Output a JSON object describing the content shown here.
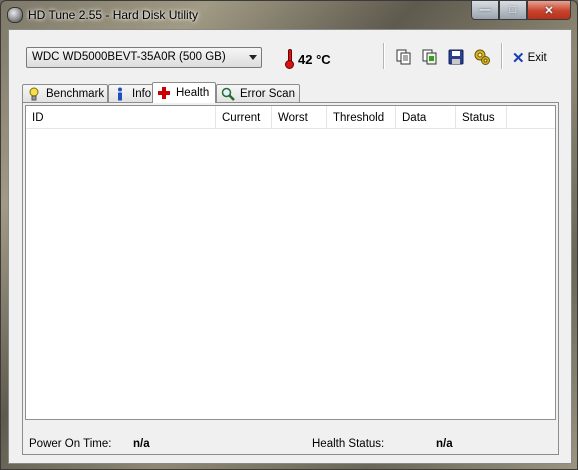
{
  "window": {
    "title": "HD Tune 2.55 - Hard Disk Utility",
    "caption_buttons": {
      "minimize": "—",
      "maximize": "□",
      "close": "✕"
    }
  },
  "toolbar": {
    "drive": "WDC WD5000BEVT-35A0R (500 GB)",
    "temperature": "42 °C",
    "exit_label": "Exit"
  },
  "tabs": [
    {
      "label": "Benchmark",
      "icon": "lightbulb-icon"
    },
    {
      "label": "Info",
      "icon": "info-icon"
    },
    {
      "label": "Health",
      "icon": "health-cross-icon",
      "active": true
    },
    {
      "label": "Error Scan",
      "icon": "magnifier-icon"
    }
  ],
  "health": {
    "columns": [
      "ID",
      "Current",
      "Worst",
      "Threshold",
      "Data",
      "Status"
    ],
    "rows": [],
    "power_on_label": "Power On Time:",
    "power_on_value": "n/a",
    "health_status_label": "Health Status:",
    "health_status_value": "n/a"
  },
  "colors": {
    "temperature_red": "#d11111",
    "health_cross_red": "#cc0000",
    "exit_blue": "#1a3fb5",
    "close_button_red": "#c7432c"
  }
}
